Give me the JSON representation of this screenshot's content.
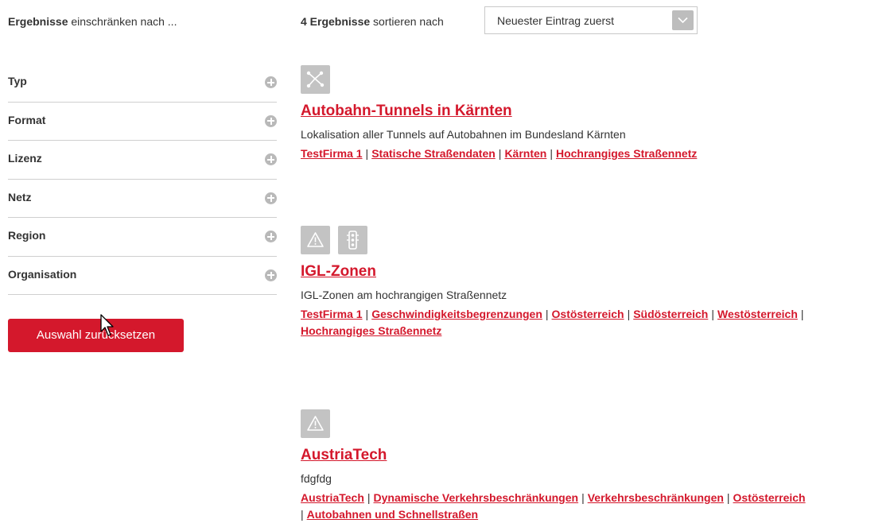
{
  "filter_header": {
    "bold": "Ergebnisse",
    "rest": "einschränken nach ..."
  },
  "filters": [
    {
      "label": "Typ"
    },
    {
      "label": "Format"
    },
    {
      "label": "Lizenz"
    },
    {
      "label": "Netz"
    },
    {
      "label": "Region"
    },
    {
      "label": "Organisation"
    }
  ],
  "reset_button": "Auswahl zurücksetzen",
  "sort": {
    "count": "4 Ergebnisse",
    "text": "sortieren nach",
    "selected": "Neuester Eintrag zuerst"
  },
  "results": [
    {
      "icons": [
        "network-icon"
      ],
      "title": "Autobahn-Tunnels in Kärnten",
      "description": "Lokalisation aller Tunnels auf Autobahnen im Bundesland Kärnten",
      "tags": [
        "TestFirma 1",
        "Statische Straßendaten",
        "Kärnten",
        "Hochrangiges Straßennetz"
      ]
    },
    {
      "icons": [
        "warning-icon",
        "traffic-light-icon"
      ],
      "title": "IGL-Zonen",
      "description": "IGL-Zonen am hochrangigen Straßennetz",
      "tags": [
        "TestFirma 1",
        "Geschwindigkeitsbegrenzungen",
        "Ostösterreich",
        "Südösterreich",
        "Westösterreich",
        "Hochrangiges Straßennetz"
      ]
    },
    {
      "icons": [
        "warning-icon"
      ],
      "title": "AustriaTech",
      "description": "fdgfdg",
      "tags": [
        "AustriaTech",
        "Dynamische Verkehrsbeschränkungen",
        "Verkehrsbeschränkungen",
        "Ostösterreich",
        "Autobahnen und Schnellstraßen"
      ]
    }
  ],
  "colors": {
    "accent": "#d4182c",
    "icon_bg": "#c3c3c3",
    "divider": "#cfcfcf"
  }
}
